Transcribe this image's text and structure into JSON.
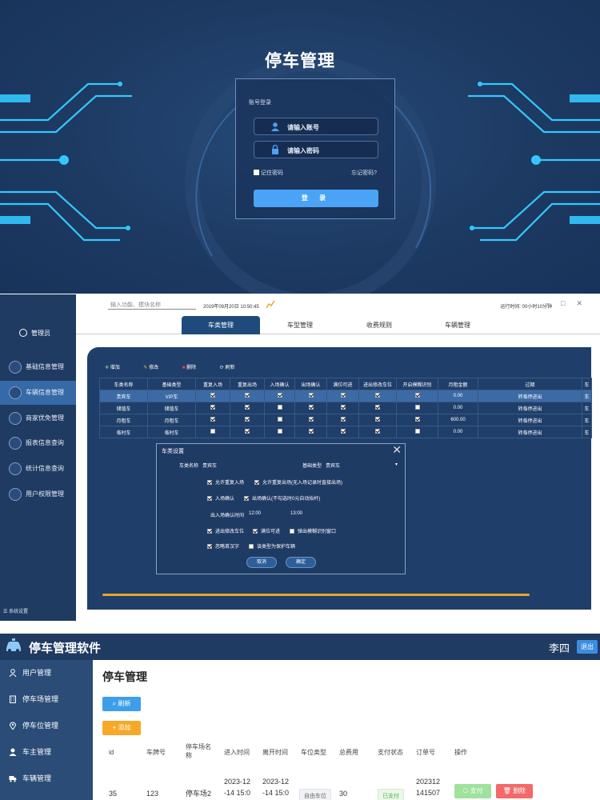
{
  "login": {
    "title": "停车管理",
    "box_caption": "账号登录",
    "account_placeholder": "请输入账号",
    "password_placeholder": "请输入密码",
    "remember_label": "记住密码",
    "forgot_label": "忘记密码?",
    "login_button": "登 录",
    "colors": {
      "background": "#1d3a63",
      "accent": "#4aa3f5",
      "circuit": "#33c8ff"
    }
  },
  "desktop": {
    "sidebar": {
      "admin": "管理员",
      "items": [
        {
          "label": "基础信息管理",
          "icon": "info-icon"
        },
        {
          "label": "车辆信息管理",
          "icon": "car-icon"
        },
        {
          "label": "商家优免管理",
          "icon": "merchant-icon"
        },
        {
          "label": "报表信息查询",
          "icon": "report-icon"
        },
        {
          "label": "统计信息查询",
          "icon": "statistics-icon"
        },
        {
          "label": "用户权限管理",
          "icon": "permission-icon"
        }
      ],
      "active_index": 1,
      "system_settings": "系统设置"
    },
    "topbar": {
      "search_placeholder": "输入功能、模块名称",
      "datetime": "2019年09月20日 10:50:45",
      "runtime": "运行时间: 00小时10分钟"
    },
    "tabs": [
      "车类管理",
      "车型管理",
      "收费规则",
      "车辆管理"
    ],
    "active_tab": 0,
    "toolbar": {
      "add": "增加",
      "edit": "修改",
      "delete": "删除",
      "refresh": "刷新"
    },
    "table": {
      "columns": [
        "车类名称",
        "基础类型",
        "重复入场",
        "重复出场",
        "入场确认",
        "出场确认",
        "满位可进",
        "进出修改车位",
        "开启模糊识别",
        "月租金额",
        "过期",
        "车"
      ],
      "rows": [
        {
          "name": "贵宾车",
          "type": "VIP车",
          "checks": [
            true,
            true,
            true,
            true,
            true,
            true,
            true
          ],
          "amount": "0.00",
          "expire": "转临停进出",
          "last": "车"
        },
        {
          "name": "储值车",
          "type": "储值车",
          "checks": [
            true,
            true,
            false,
            true,
            true,
            true,
            false
          ],
          "amount": "0.00",
          "expire": "转临停进出",
          "last": "车"
        },
        {
          "name": "月租车",
          "type": "月租车",
          "checks": [
            true,
            true,
            false,
            true,
            true,
            true,
            true
          ],
          "amount": "600.00",
          "expire": "转临停进出",
          "last": "车"
        },
        {
          "name": "临时车",
          "type": "临时车",
          "checks": [
            false,
            true,
            false,
            true,
            true,
            true,
            false
          ],
          "amount": "0.00",
          "expire": "转临停进出",
          "last": "车"
        }
      ],
      "selected_row": 0
    },
    "dialog": {
      "title": "车类设置",
      "name_label": "车类名称",
      "name_value": "贵宾车",
      "type_label": "基础类型",
      "type_value": "贵宾车",
      "opt_repeat_in": "允许重复入场",
      "opt_repeat_out": "允许重复出场(无入场记录时直接出场)",
      "opt_in_confirm": "入场确认",
      "opt_out_confirm": "出场确认(不勾选时0元自动抬杆)",
      "time_label": "出入场确认时间",
      "time_start": "12:00",
      "time_end": "13:00",
      "opt_modify_slot": "进出修改车位",
      "opt_full_enter": "满位可进",
      "opt_fuzzy_window": "弹出模糊识别窗口",
      "opt_chinese": "忽略首汉字",
      "opt_protect": "该类型为保护车辆",
      "cancel": "取消",
      "ok": "确定"
    }
  },
  "web": {
    "app_title": "停车管理软件",
    "user": "李四",
    "logout": "退出",
    "sidebar": [
      {
        "label": "用户管理",
        "icon": "user-icon"
      },
      {
        "label": "停车场管理",
        "icon": "building-icon"
      },
      {
        "label": "停车位管理",
        "icon": "location-icon"
      },
      {
        "label": "车主管理",
        "icon": "person-icon"
      },
      {
        "label": "车辆管理",
        "icon": "truck-icon"
      }
    ],
    "page_title": "停车管理",
    "refresh": "刷新",
    "add": "+ 添加",
    "columns": [
      "id",
      "车牌号",
      "停车场名称",
      "进入时间",
      "离开时间",
      "车位类型",
      "总费用",
      "支付状态",
      "订单号",
      "操作"
    ],
    "row": {
      "id": "35",
      "plate": "123",
      "lot": "停车场2",
      "enter_time": "2023-12\n-14 15:0",
      "leave_time": "2023-12\n-14 15:0",
      "slot_type": "自由车位",
      "fee": "30",
      "pay_status": "已支付",
      "order_no": "202312\n141507",
      "pay_btn": "支付",
      "delete_btn": "删除"
    }
  }
}
